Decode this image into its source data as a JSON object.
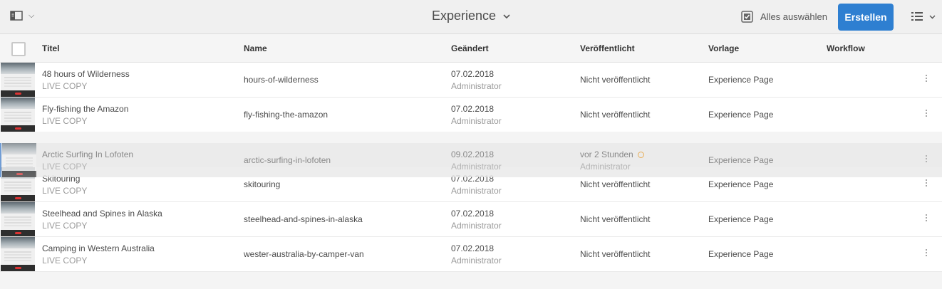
{
  "toolbar": {
    "title": "Experience",
    "select_all_label": "Alles auswählen",
    "create_label": "Erstellen"
  },
  "columns": [
    "Titel",
    "Name",
    "Geändert",
    "Veröffentlicht",
    "Vorlage",
    "Workflow"
  ],
  "rows": [
    {
      "title": "48 hours of Wilderness",
      "subtitle": "LIVE COPY",
      "name": "hours-of-wilderness",
      "modified_date": "07.02.2018",
      "modified_by": "Administrator",
      "published": "Nicht veröffentlicht",
      "template": "Experience Page"
    },
    {
      "title": "Fly-fishing the Amazon",
      "subtitle": "LIVE COPY",
      "name": "fly-fishing-the-amazon",
      "modified_date": "07.02.2018",
      "modified_by": "Administrator",
      "published": "Nicht veröffentlicht",
      "template": "Experience Page"
    },
    {
      "title": "Skitouring",
      "subtitle": "LIVE COPY",
      "name": "skitouring",
      "modified_date": "07.02.2018",
      "modified_by": "Administrator",
      "published": "Nicht veröffentlicht",
      "template": "Experience Page"
    },
    {
      "title": "Steelhead and Spines in Alaska",
      "subtitle": "LIVE COPY",
      "name": "steelhead-and-spines-in-alaska",
      "modified_date": "07.02.2018",
      "modified_by": "Administrator",
      "published": "Nicht veröffentlicht",
      "template": "Experience Page"
    },
    {
      "title": "Camping in Western Australia",
      "subtitle": "LIVE COPY",
      "name": "wester-australia-by-camper-van",
      "modified_date": "07.02.2018",
      "modified_by": "Administrator",
      "published": "Nicht veröffentlicht",
      "template": "Experience Page"
    }
  ],
  "dragged_row": {
    "title": "Arctic Surfing In Lofoten",
    "subtitle": "LIVE COPY",
    "name": "arctic-surfing-in-lofoten",
    "modified_date": "09.02.2018",
    "modified_by": "Administrator",
    "published": "vor 2 Stunden",
    "published_by": "Administrator",
    "template": "Experience Page"
  },
  "colors": {
    "accent": "#2e7fd1",
    "pending_clock": "#e6a23c"
  },
  "icons": [
    "side-panel-icon",
    "chevron-down-icon",
    "checkbox-checked-icon",
    "list-view-icon",
    "clock-icon",
    "more-icon"
  ]
}
